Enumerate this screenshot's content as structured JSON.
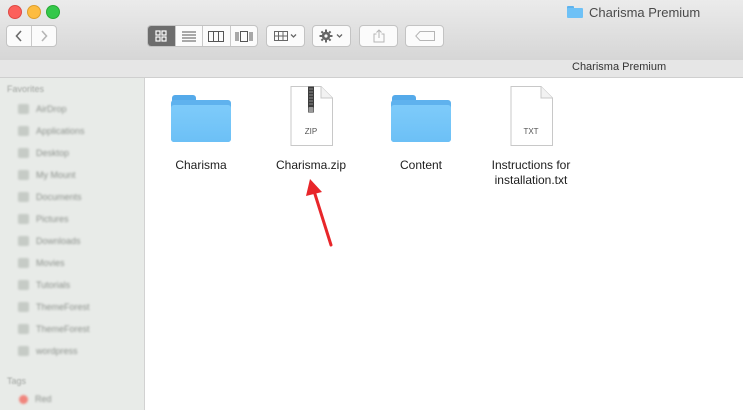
{
  "window": {
    "title": "Charisma Premium",
    "path": "Charisma Premium",
    "icon": "folder-icon"
  },
  "toolbar": {
    "back": "‹",
    "forward": "›",
    "view_modes": [
      {
        "name": "icon-view",
        "active": true
      },
      {
        "name": "list-view",
        "active": false
      },
      {
        "name": "column-view",
        "active": false
      },
      {
        "name": "cover-flow-view",
        "active": false
      }
    ],
    "arrange_icon": "arrange-grid-icon",
    "action_icon": "gear-icon",
    "share_icon": "share-icon",
    "tag_icon": "tag-icon"
  },
  "sidebar": {
    "sections": [
      {
        "header": "Favorites",
        "items": [
          "AirDrop",
          "Applications",
          "Desktop",
          "My Mount",
          "Documents",
          "Pictures",
          "Downloads",
          "Movies",
          "Tutorials",
          "ThemeForest",
          "ThemeForest",
          "wordpress"
        ]
      },
      {
        "header": "Tags",
        "items": [
          "Red"
        ]
      }
    ]
  },
  "files": [
    {
      "name": "Charisma",
      "type": "folder"
    },
    {
      "name": "Charisma.zip",
      "type": "zip",
      "ext": "ZIP"
    },
    {
      "name": "Content",
      "type": "folder"
    },
    {
      "name": "Instructions for installation.txt",
      "type": "text",
      "ext": "TXT"
    }
  ],
  "colors": {
    "folder": "#6ec1f6",
    "annotation_arrow": "#e8262a",
    "close": "#fc605b",
    "minimize": "#fdbc40",
    "maximize": "#34c84a"
  }
}
